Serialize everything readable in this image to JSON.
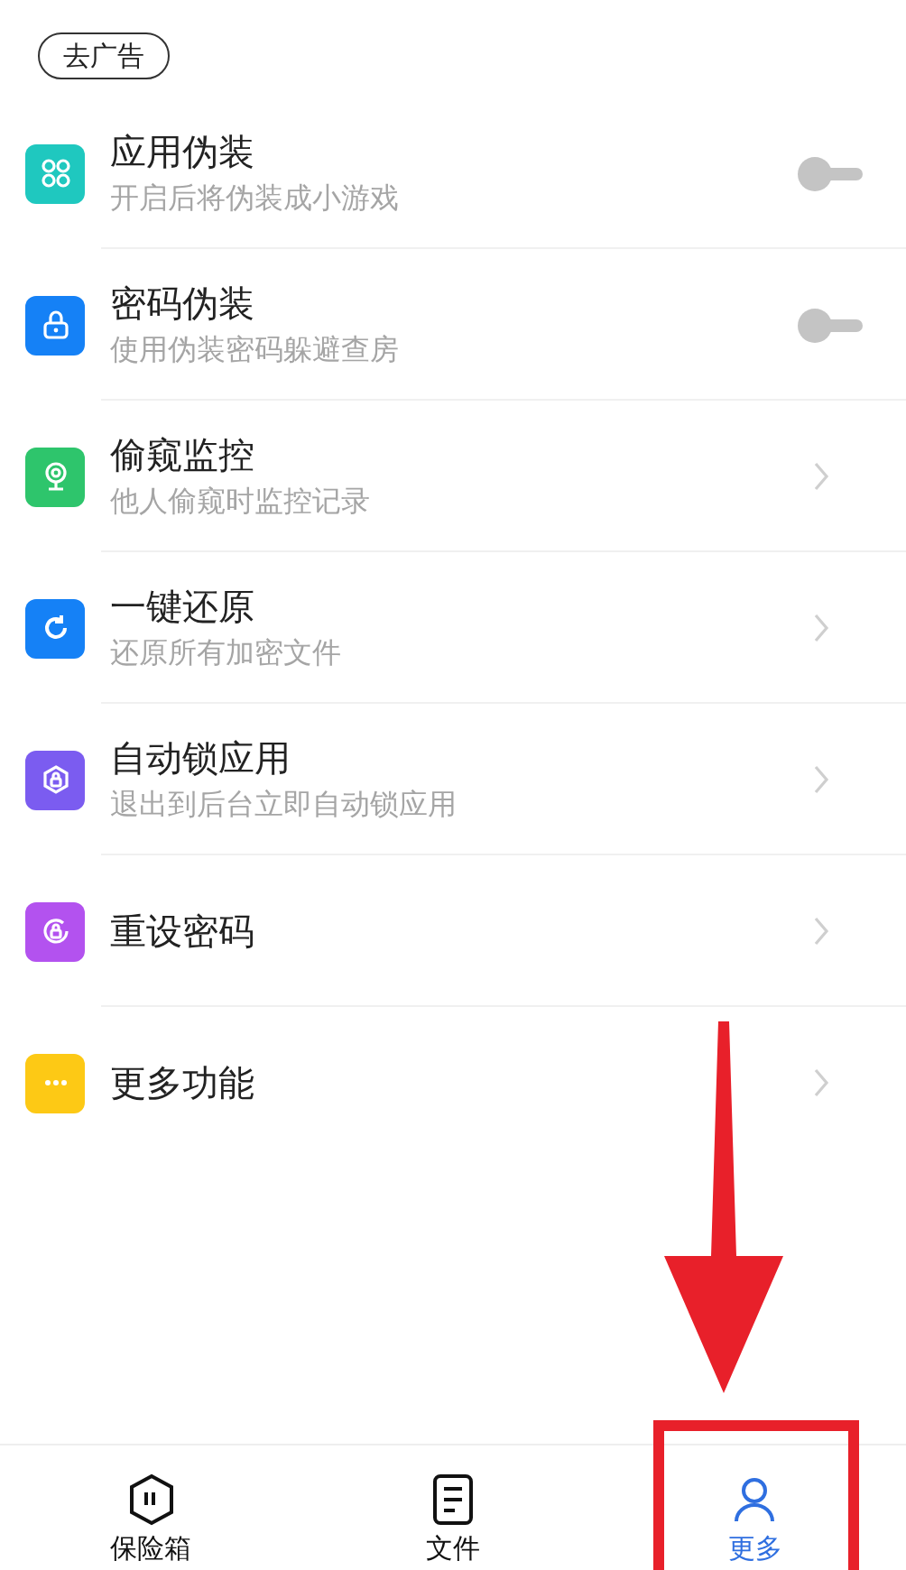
{
  "header": {
    "button": "去广告"
  },
  "items": [
    {
      "kind": "toggle",
      "color": "#1fc8bf",
      "title": "应用伪装",
      "subtitle": "开启后将伪装成小游戏",
      "on": false
    },
    {
      "kind": "toggle",
      "color": "#1581f6",
      "title": "密码伪装",
      "subtitle": "使用伪装密码躲避查房",
      "on": false
    },
    {
      "kind": "link",
      "color": "#2ec56c",
      "title": "偷窥监控",
      "subtitle": "他人偷窥时监控记录"
    },
    {
      "kind": "link",
      "color": "#1581f6",
      "title": "一键还原",
      "subtitle": "还原所有加密文件"
    },
    {
      "kind": "link",
      "color": "#7b5cf0",
      "title": "自动锁应用",
      "subtitle": "退出到后台立即自动锁应用"
    },
    {
      "kind": "link",
      "color": "#b352ef",
      "title": "重设密码"
    },
    {
      "kind": "link",
      "color": "#fdc915",
      "title": "更多功能"
    }
  ],
  "tabs": [
    {
      "label": "保险箱",
      "selected": false
    },
    {
      "label": "文件",
      "selected": false
    },
    {
      "label": "更多",
      "selected": true
    }
  ]
}
